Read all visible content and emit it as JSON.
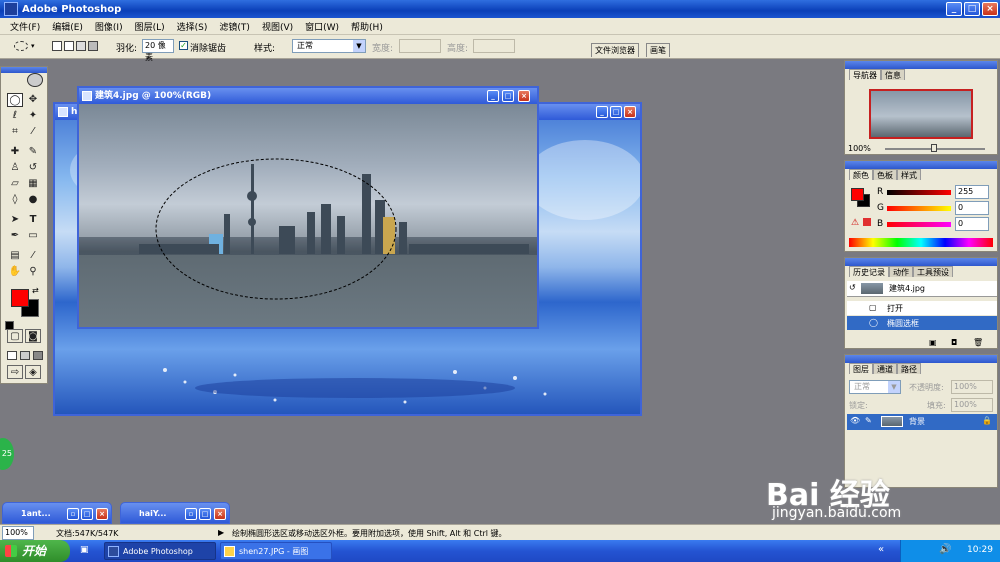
{
  "app": {
    "title": "Adobe Photoshop"
  },
  "window_controls": {
    "minimize": "_",
    "maximize": "□",
    "close": "×"
  },
  "menu": [
    "文件(F)",
    "编辑(E)",
    "图像(I)",
    "图层(L)",
    "选择(S)",
    "滤镜(T)",
    "视图(V)",
    "窗口(W)",
    "帮助(H)"
  ],
  "options": {
    "feather_label": "羽化:",
    "feather_value": "20 像素",
    "antialias_label": "消除锯齿",
    "antialias_checked": true,
    "style_label": "样式:",
    "style_value": "正常",
    "width_label": "宽度:",
    "height_label": "高度:",
    "tabs": [
      "文件浏览器",
      "画笔"
    ]
  },
  "documents": {
    "front": {
      "title": "建筑4.jpg @ 100%(RGB)"
    },
    "back": {
      "title": "h"
    }
  },
  "minimized": [
    {
      "title": "1ant..."
    },
    {
      "title": "haiY..."
    }
  ],
  "navigator": {
    "tabs": [
      "导航器",
      "信息"
    ],
    "zoom": "100%"
  },
  "color": {
    "tabs": [
      "颜色",
      "色板",
      "样式"
    ],
    "r_label": "R",
    "g_label": "G",
    "b_label": "B",
    "r": "255",
    "g": "0",
    "b": "0",
    "foreground": "#ff0000",
    "background": "#000000"
  },
  "history": {
    "tabs": [
      "历史记录",
      "动作",
      "工具预设"
    ],
    "snapshot": "建筑4.jpg",
    "steps": [
      "打开",
      "椭圆选框"
    ]
  },
  "layers": {
    "tabs": [
      "图层",
      "通道",
      "路径"
    ],
    "blend_mode": "正常",
    "opacity_label": "不透明度:",
    "opacity": "100%",
    "lock_label": "锁定:",
    "fill_label": "填充:",
    "fill": "100%",
    "layer_name": "背景"
  },
  "status": {
    "zoom": "100%",
    "doc_info": "文档:547K/547K",
    "hint": "绘制椭圆形选区或移动选区外框。要用附加选项，使用 Shift, Alt 和 Ctrl 键。"
  },
  "taskbar": {
    "start": "开始",
    "tasks": [
      "Adobe Photoshop",
      "shen27.JPG - 画图"
    ],
    "clock": "10:29"
  },
  "side_badge": "25",
  "watermark": {
    "brand": "Bai  经验",
    "url": "jingyan.baidu.com"
  }
}
